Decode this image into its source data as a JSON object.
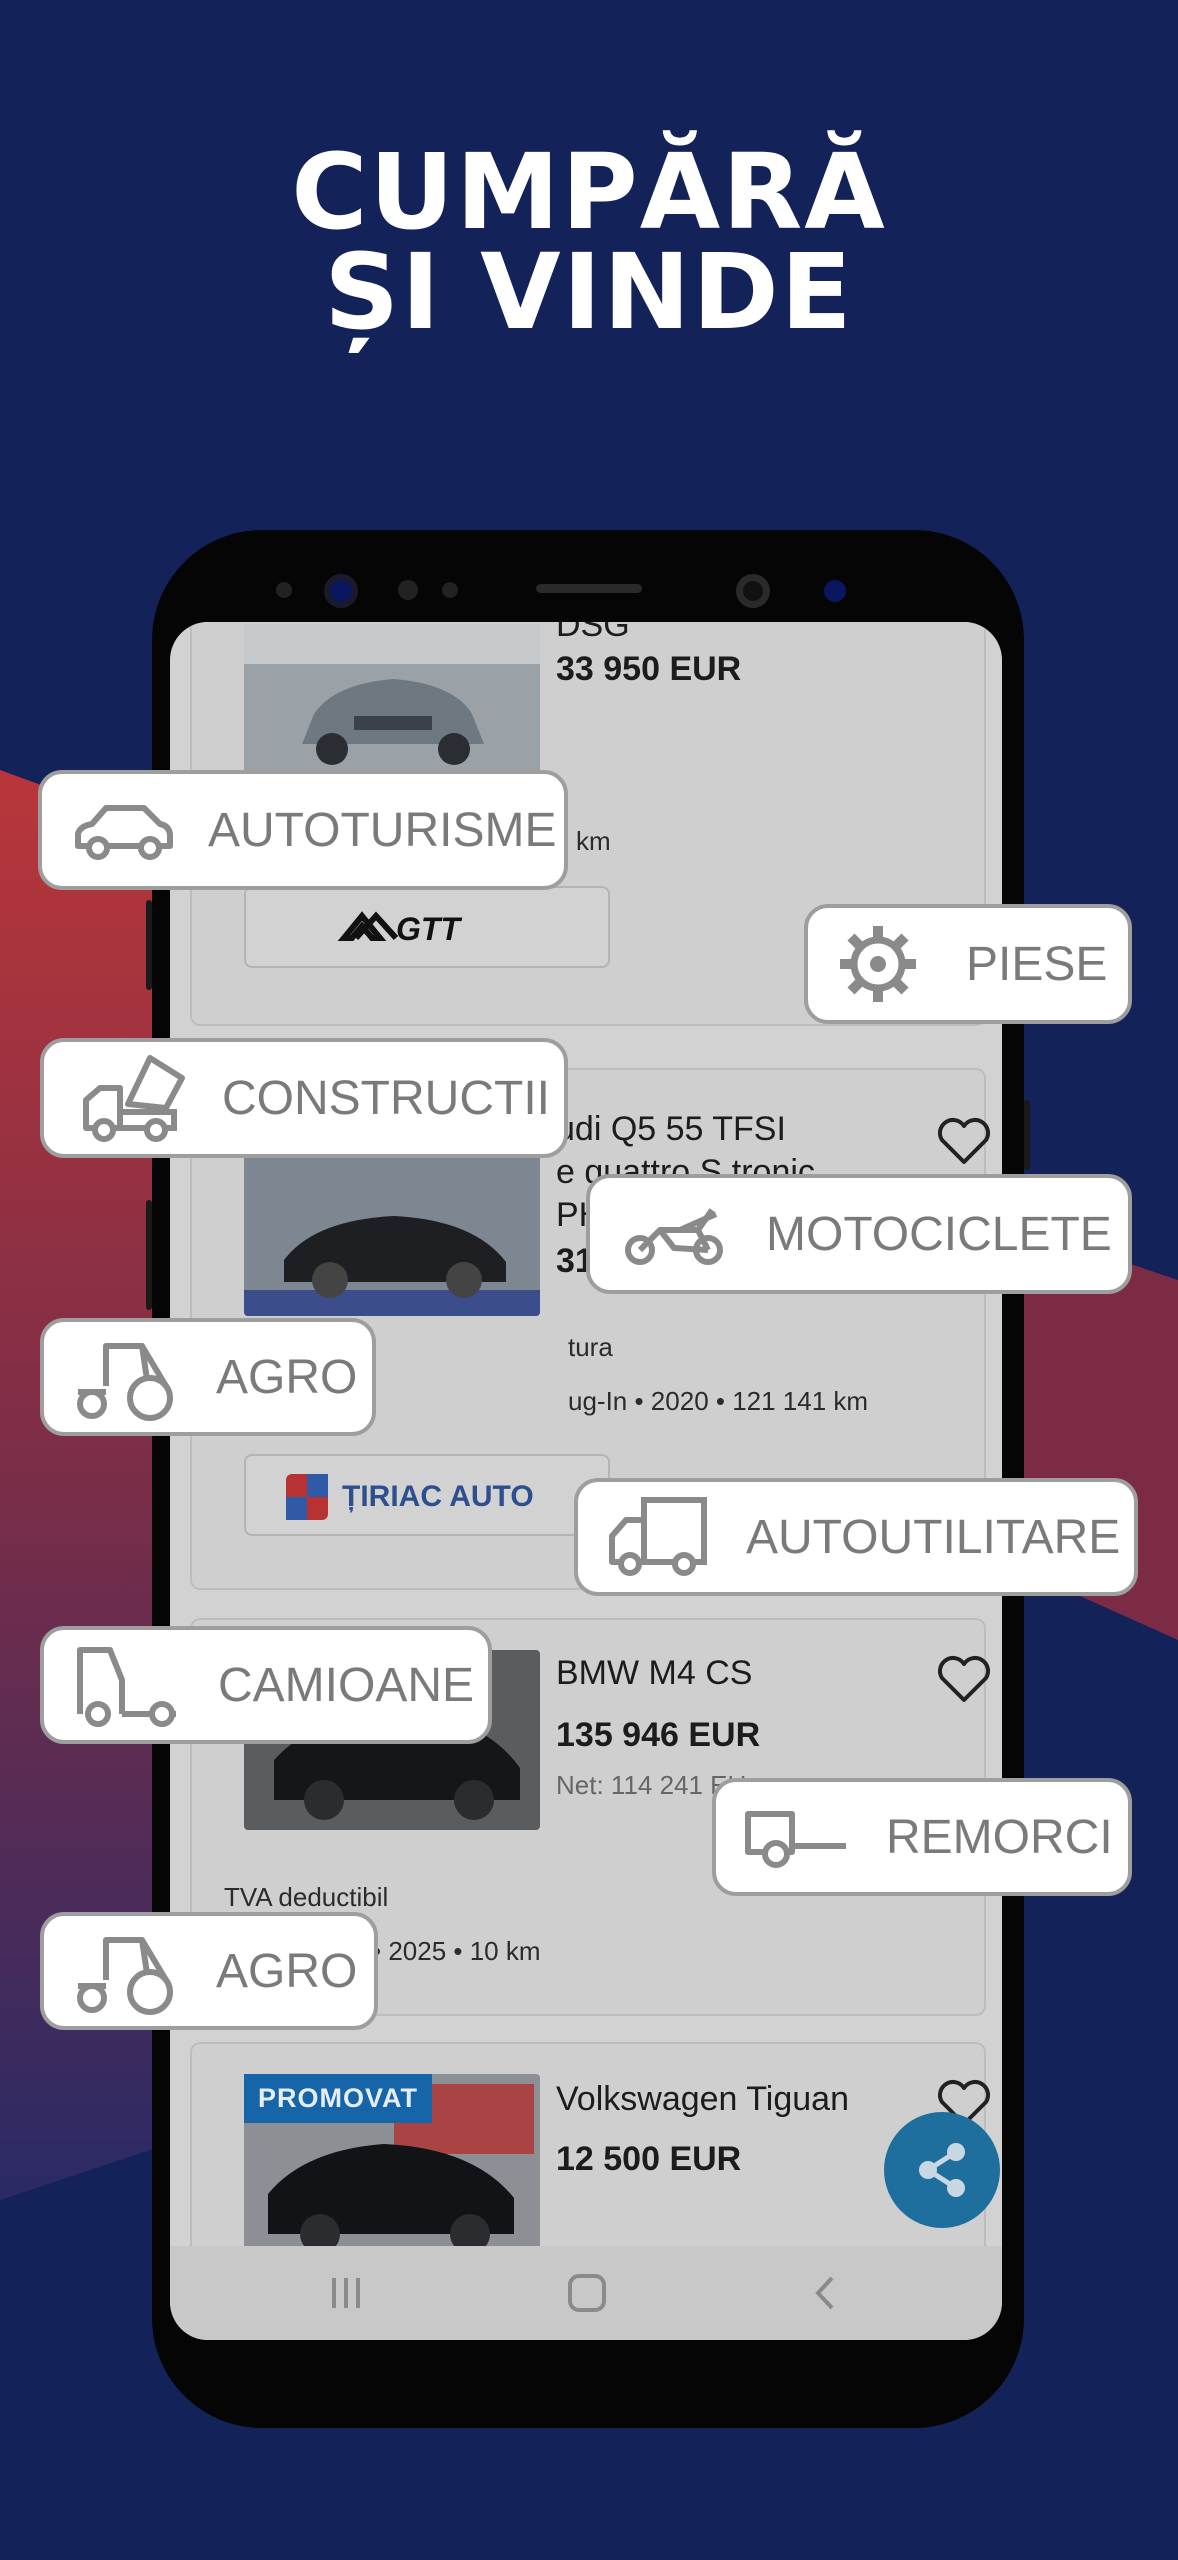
{
  "headline": {
    "line1": "CUMPĂRĂ",
    "line2": "ȘI VINDE"
  },
  "colors": {
    "background": "#14225a",
    "accent_red": "#b5353a",
    "promo_badge": "#1565a8",
    "fab": "#1e6f9e"
  },
  "listings": [
    {
      "title": "DSG",
      "price": "33 950 EUR",
      "meta": "km",
      "dealer": "GTT"
    },
    {
      "title_line1": "udi Q5 55 TFSI",
      "title_line2": "e quattro S tronic",
      "title_line3": "PH",
      "price": "31",
      "meta_line1": "tura",
      "meta_line2": "ug-In • 2020 • 121 141 km",
      "dealer": "ȚIRIAC AUTO"
    },
    {
      "title": "BMW M4 CS",
      "price": "135 946 EUR",
      "net": "Net: 114 241 EU",
      "meta_line1": "TVA deductibil",
      "meta_line2": "• 2025 • 10 km"
    },
    {
      "badge": "PROMOVAT",
      "title": "Volkswagen Tiguan",
      "price": "12 500 EUR"
    }
  ],
  "categories": [
    {
      "label": "AUTOTURISME",
      "icon": "car-icon"
    },
    {
      "label": "PIESE",
      "icon": "gear-icon"
    },
    {
      "label": "CONSTRUCTII",
      "icon": "dump-truck-icon"
    },
    {
      "label": "MOTOCICLETE",
      "icon": "motorcycle-icon"
    },
    {
      "label": "AGRO",
      "icon": "tractor-icon"
    },
    {
      "label": "AUTOUTILITARE",
      "icon": "van-icon"
    },
    {
      "label": "CAMIOANE",
      "icon": "truck-icon"
    },
    {
      "label": "REMORCI",
      "icon": "trailer-icon"
    },
    {
      "label": "AGRO",
      "icon": "tractor-icon"
    }
  ],
  "icons": {
    "favorite": "heart-icon",
    "share": "share-icon",
    "nav_recent": "recent-apps-icon",
    "nav_home": "home-icon",
    "nav_back": "back-icon"
  }
}
